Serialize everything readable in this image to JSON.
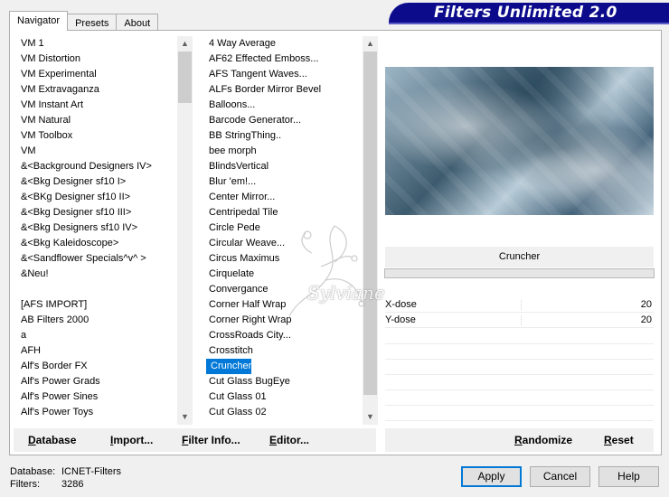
{
  "tabs": [
    {
      "label": "Navigator",
      "active": true
    },
    {
      "label": "Presets",
      "active": false
    },
    {
      "label": "About",
      "active": false
    }
  ],
  "app_title": "Filters Unlimited 2.0",
  "categories": [
    "VM 1",
    "VM Distortion",
    "VM Experimental",
    "VM Extravaganza",
    "VM Instant Art",
    "VM Natural",
    "VM Toolbox",
    "VM",
    "&<Background Designers IV>",
    "&<Bkg Designer sf10 I>",
    "&<BKg Designer sf10 II>",
    "&<Bkg Designer sf10 III>",
    "&<Bkg Designers sf10 IV>",
    "&<Bkg Kaleidoscope>",
    "&<Sandflower Specials^v^ >",
    "&Neu!",
    "",
    "[AFS IMPORT]",
    "AB Filters 2000",
    "a",
    "AFH",
    "Alf's Border FX",
    "Alf's Power Grads",
    "Alf's Power Sines",
    "Alf's Power Toys"
  ],
  "filters": [
    "4 Way Average",
    "AF62 Effected Emboss...",
    "AFS Tangent Waves...",
    "ALFs Border Mirror Bevel",
    "Balloons...",
    "Barcode Generator...",
    "BB StringThing..",
    "bee morph",
    "BlindsVertical",
    "Blur 'em!...",
    "Center Mirror...",
    "Centripedal Tile",
    "Circle Pede",
    "Circular Weave...",
    "Circus Maximus",
    "Cirquelate",
    "Convergance",
    "Corner Half Wrap",
    "Corner Right Wrap",
    "CrossRoads City...",
    "Crosstitch",
    "Cruncher",
    "Cut Glass  BugEye",
    "Cut Glass 01",
    "Cut Glass 02"
  ],
  "selected_filter": "Cruncher",
  "selected_filter_title": "Cruncher",
  "params": [
    {
      "label": "X-dose",
      "value": "20"
    },
    {
      "label": "Y-dose",
      "value": "20"
    }
  ],
  "left_buttons": {
    "database": "Database",
    "import": "Import...",
    "filter_info": "Filter Info...",
    "editor": "Editor..."
  },
  "right_buttons": {
    "randomize": "Randomize",
    "reset": "Reset"
  },
  "status": {
    "database_label": "Database:",
    "database_value": "ICNET-Filters",
    "filters_label": "Filters:",
    "filters_value": "3286"
  },
  "dialog_buttons": {
    "apply": "Apply",
    "cancel": "Cancel",
    "help": "Help"
  },
  "watermark": "Sylviane",
  "colors": {
    "title_bar": "#0b0b8c",
    "selection": "#0078d7"
  }
}
